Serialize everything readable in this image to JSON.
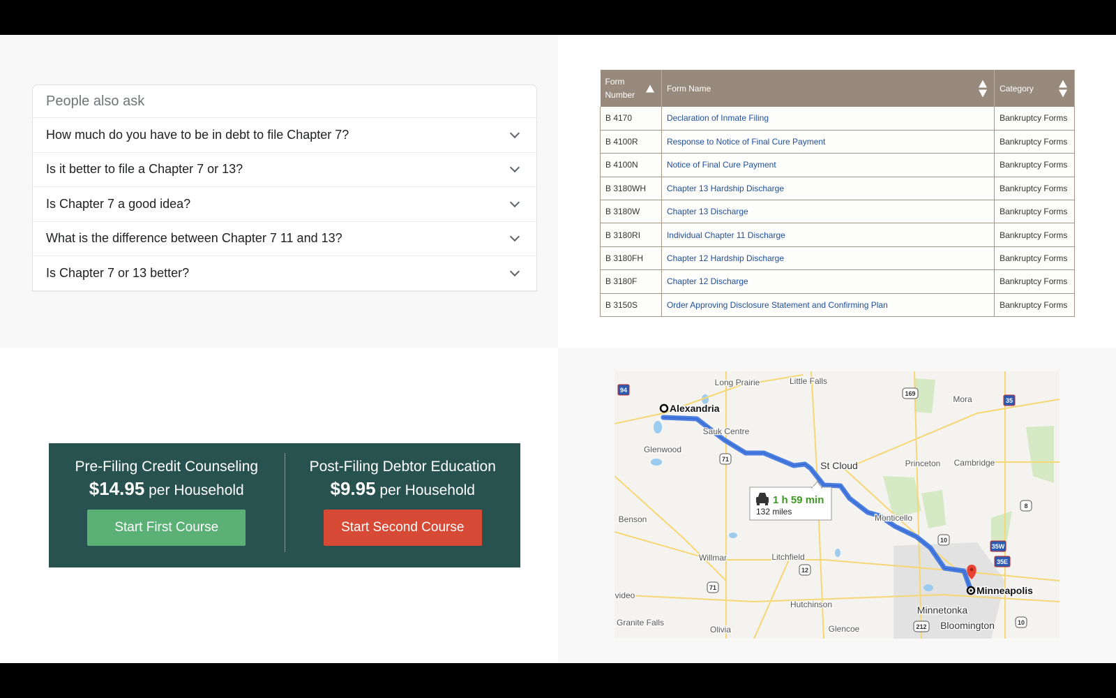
{
  "paa": {
    "title": "People also ask",
    "questions": [
      "How much do you have to be in debt to file Chapter 7?",
      "Is it better to file a Chapter 7 or 13?",
      "Is Chapter 7 a good idea?",
      "What is the difference between Chapter 7 11 and 13?",
      "Is Chapter 7 or 13 better?"
    ]
  },
  "forms": {
    "headers": {
      "number": "Form Number",
      "name": "Form Name",
      "category": "Category"
    },
    "rows": [
      {
        "number": "B 4170",
        "name": "Declaration of Inmate Filing",
        "category": "Bankruptcy Forms"
      },
      {
        "number": "B 4100R",
        "name": "Response to Notice of Final Cure Payment",
        "category": "Bankruptcy Forms"
      },
      {
        "number": "B 4100N",
        "name": "Notice of Final Cure Payment",
        "category": "Bankruptcy Forms"
      },
      {
        "number": "B 3180WH",
        "name": "Chapter 13 Hardship Discharge",
        "category": "Bankruptcy Forms"
      },
      {
        "number": "B 3180W",
        "name": "Chapter 13 Discharge",
        "category": "Bankruptcy Forms"
      },
      {
        "number": "B 3180RI",
        "name": "Individual Chapter 11 Discharge",
        "category": "Bankruptcy Forms"
      },
      {
        "number": "B 3180FH",
        "name": "Chapter 12 Hardship Discharge",
        "category": "Bankruptcy Forms"
      },
      {
        "number": "B 3180F",
        "name": "Chapter 12 Discharge",
        "category": "Bankruptcy Forms"
      },
      {
        "number": "B 3150S",
        "name": "Order Approving Disclosure Statement and Confirming Plan",
        "category": "Bankruptcy Forms"
      }
    ]
  },
  "courses": [
    {
      "title": "Pre-Filing Credit Counseling",
      "price": "$14.95",
      "unit": " per Household",
      "button": "Start First Course",
      "color": "#5bb175"
    },
    {
      "title": "Post-Filing Debtor Education",
      "price": "$9.95",
      "unit": " per Household",
      "button": "Start Second Course",
      "color": "#d64a36"
    }
  ],
  "map": {
    "origin": "Alexandria",
    "destination": "Minneapolis",
    "duration": "1 h 59 min",
    "distance": "132 miles",
    "route_color": "#4a7de0",
    "places": [
      "Long Prairie",
      "Little Falls",
      "Sauk Centre",
      "Glenwood",
      "St Cloud",
      "Princeton",
      "Cambridge",
      "Mora",
      "Benson",
      "Monticello",
      "Willmar",
      "Litchfield",
      "Hutchinson",
      "Minnetonka",
      "Bloomington",
      "Granite Falls",
      "Olivia",
      "Glencoe",
      "video"
    ],
    "shields": [
      "94",
      "169",
      "35",
      "71",
      "71",
      "12",
      "10",
      "8",
      "35W",
      "35E",
      "212",
      "10"
    ]
  }
}
